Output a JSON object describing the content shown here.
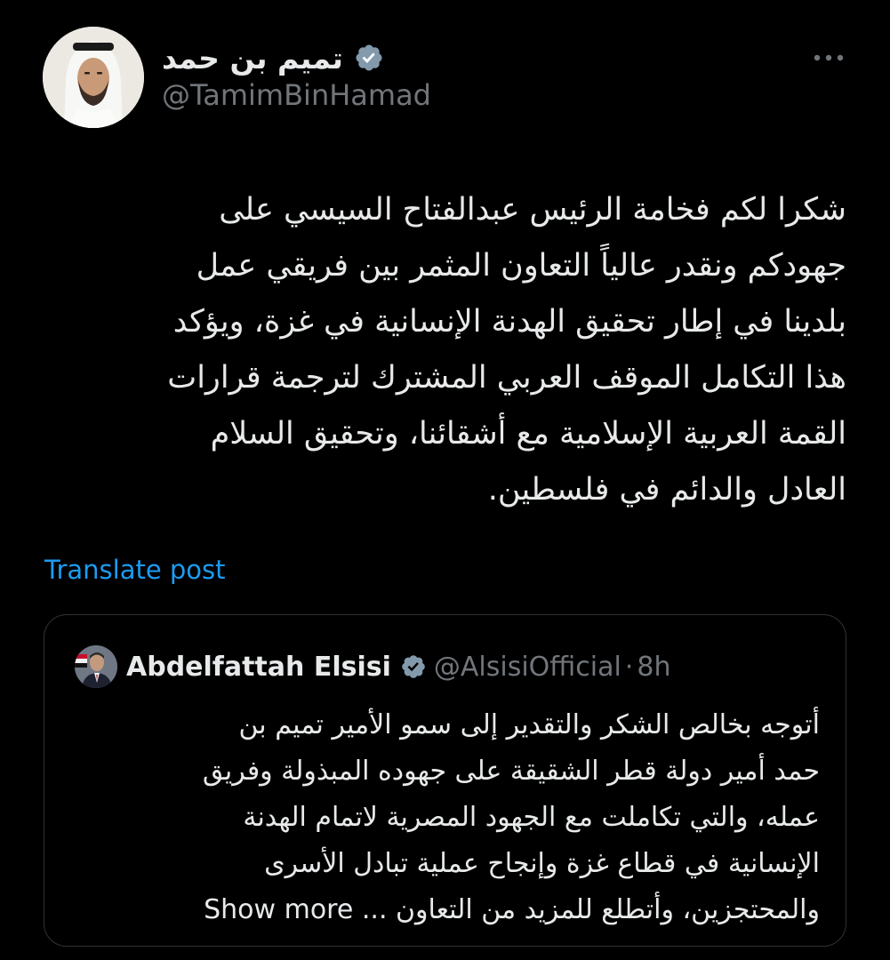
{
  "author": {
    "display_name": "تميم بن حمد",
    "handle": "@TamimBinHamad"
  },
  "tweet": {
    "lines": [
      "شكرا لكم فخامة الرئيس عبدالفتاح السيسي على",
      "جهودكم ونقدر عالياً التعاون المثمر بين فريقي عمل",
      "بلدينا في إطار تحقيق الهدنة الإنسانية في غزة، ويؤكد",
      "هذا التكامل الموقف العربي المشترك لترجمة قرارات",
      "القمة العربية الإسلامية مع أشقائنا، وتحقيق السلام",
      "العادل والدائم في فلسطين."
    ],
    "translate_label": "Translate post"
  },
  "quoted": {
    "name": "Abdelfattah Elsisi",
    "handle": "@AlsisiOfficial",
    "separator": "·",
    "time": "8h",
    "lines": [
      "أتوجه بخالص الشكر والتقدير إلى سمو الأمير تميم بن",
      "حمد أمير دولة قطر الشقيقة على جهوده المبذولة وفريق",
      "عمله، والتي تكاملت مع الجهود المصرية لاتمام الهدنة",
      "الإنسانية في قطاع غزة وإنجاح عملية تبادل الأسرى",
      "والمحتجزين، وأتطلع للمزيد من التعاون ..."
    ],
    "show_more_label": "Show more"
  },
  "icons": {
    "verified": "verified-badge-icon",
    "more": "more-options-icon"
  },
  "colors": {
    "background": "#000000",
    "text": "#e7e9ea",
    "secondary": "#71767b",
    "link": "#1d9bf0",
    "border": "#2f3336",
    "verified_badge": "#829aab"
  }
}
